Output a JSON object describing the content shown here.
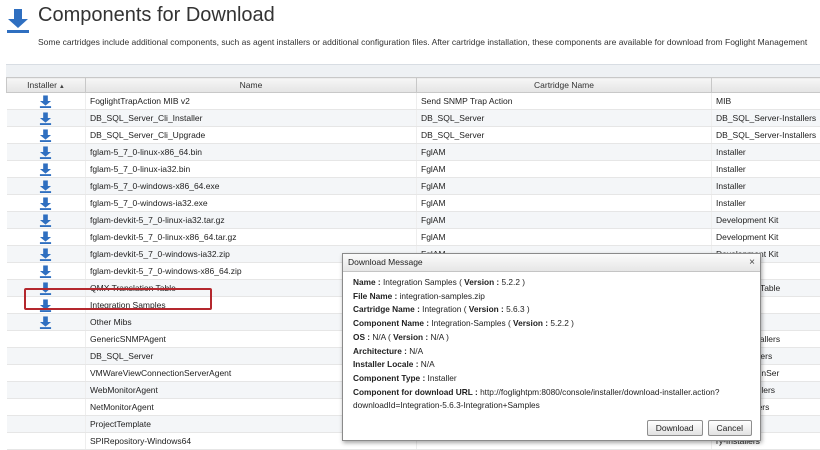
{
  "header": {
    "title": "Components for Download",
    "description": "Some cartridges include additional components, such as agent installers or additional configuration files. After cartridge installation, these components are available for download from Foglight Management"
  },
  "grid": {
    "columns": {
      "installer": "Installer",
      "name": "Name",
      "cartridge": "Cartridge Name",
      "type": ""
    },
    "sort_indicator": "▲",
    "rows": [
      {
        "icon": true,
        "name": "FoglightTrapAction MIB v2",
        "cartridge": "Send SNMP Trap Action",
        "type": "MIB"
      },
      {
        "icon": true,
        "name": "DB_SQL_Server_Cli_Installer",
        "cartridge": "DB_SQL_Server",
        "type": "DB_SQL_Server-Installers"
      },
      {
        "icon": true,
        "name": "DB_SQL_Server_Cli_Upgrade",
        "cartridge": "DB_SQL_Server",
        "type": "DB_SQL_Server-Installers"
      },
      {
        "icon": true,
        "name": "fglam-5_7_0-linux-x86_64.bin",
        "cartridge": "FglAM",
        "type": "Installer"
      },
      {
        "icon": true,
        "name": "fglam-5_7_0-linux-ia32.bin",
        "cartridge": "FglAM",
        "type": "Installer"
      },
      {
        "icon": true,
        "name": "fglam-5_7_0-windows-x86_64.exe",
        "cartridge": "FglAM",
        "type": "Installer"
      },
      {
        "icon": true,
        "name": "fglam-5_7_0-windows-ia32.exe",
        "cartridge": "FglAM",
        "type": "Installer"
      },
      {
        "icon": true,
        "name": "fglam-devkit-5_7_0-linux-ia32.tar.gz",
        "cartridge": "FglAM",
        "type": "Development Kit"
      },
      {
        "icon": true,
        "name": "fglam-devkit-5_7_0-linux-x86_64.tar.gz",
        "cartridge": "FglAM",
        "type": "Development Kit"
      },
      {
        "icon": true,
        "name": "fglam-devkit-5_7_0-windows-ia32.zip",
        "cartridge": "FglAM",
        "type": "Development Kit"
      },
      {
        "icon": true,
        "name": "fglam-devkit-5_7_0-windows-x86_64.zip",
        "cartridge": "",
        "type": "Kit"
      },
      {
        "icon": true,
        "name": "QMX Translation Table",
        "cartridge": "",
        "type": "Translation Table"
      },
      {
        "icon": true,
        "name": "Integration Samples",
        "cartridge": "",
        "type": "Samples"
      },
      {
        "icon": true,
        "name": "Other Mibs",
        "cartridge": "",
        "type": ""
      },
      {
        "icon": false,
        "name": "GenericSNMPAgent",
        "cartridge": "",
        "type": "PAgent-Installers"
      },
      {
        "icon": false,
        "name": "DB_SQL_Server",
        "cartridge": "",
        "type": "erver-Installers"
      },
      {
        "icon": false,
        "name": "VMWareViewConnectionServerAgent",
        "cartridge": "",
        "type": "v-ConnectionSer"
      },
      {
        "icon": false,
        "name": "WebMonitorAgent",
        "cartridge": "",
        "type": "Agent-Installers"
      },
      {
        "icon": false,
        "name": "NetMonitorAgent",
        "cartridge": "",
        "type": "gent-Installers"
      },
      {
        "icon": false,
        "name": "ProjectTemplate",
        "cartridge": "",
        "type": ""
      },
      {
        "icon": false,
        "name": "SPIRepository-Windows64",
        "cartridge": "",
        "type": "ry-Installers"
      }
    ]
  },
  "dialog": {
    "title": "Download Message",
    "close": "×",
    "name_label": "Name :",
    "name_value": "Integration Samples",
    "version_label": "Version :",
    "name_version": "5.2.2",
    "file_label": "File Name :",
    "file_value": "integration-samples.zip",
    "cartridge_label": "Cartridge Name :",
    "cartridge_value": "Integration",
    "cartridge_version": "5.6.3",
    "component_label": "Component Name :",
    "component_value": "Integration-Samples",
    "component_version": "5.2.2",
    "os_label": "OS :",
    "os_value": "N/A",
    "os_version": "N/A",
    "arch_label": "Architecture :",
    "arch_value": "N/A",
    "locale_label": "Installer Locale :",
    "locale_value": "N/A",
    "type_label": "Component Type :",
    "type_value": "Installer",
    "url_label": "Component for download URL :",
    "url_value_1": "http://foglightpm:8080/console/installer/download-installer.action?",
    "url_value_2": "downloadId=Integration-5.6.3-Integration+Samples",
    "download_button": "Download",
    "cancel_button": "Cancel"
  },
  "colors": {
    "icon_blue": "#2f6fc0",
    "highlight_red": "#b4282e"
  }
}
